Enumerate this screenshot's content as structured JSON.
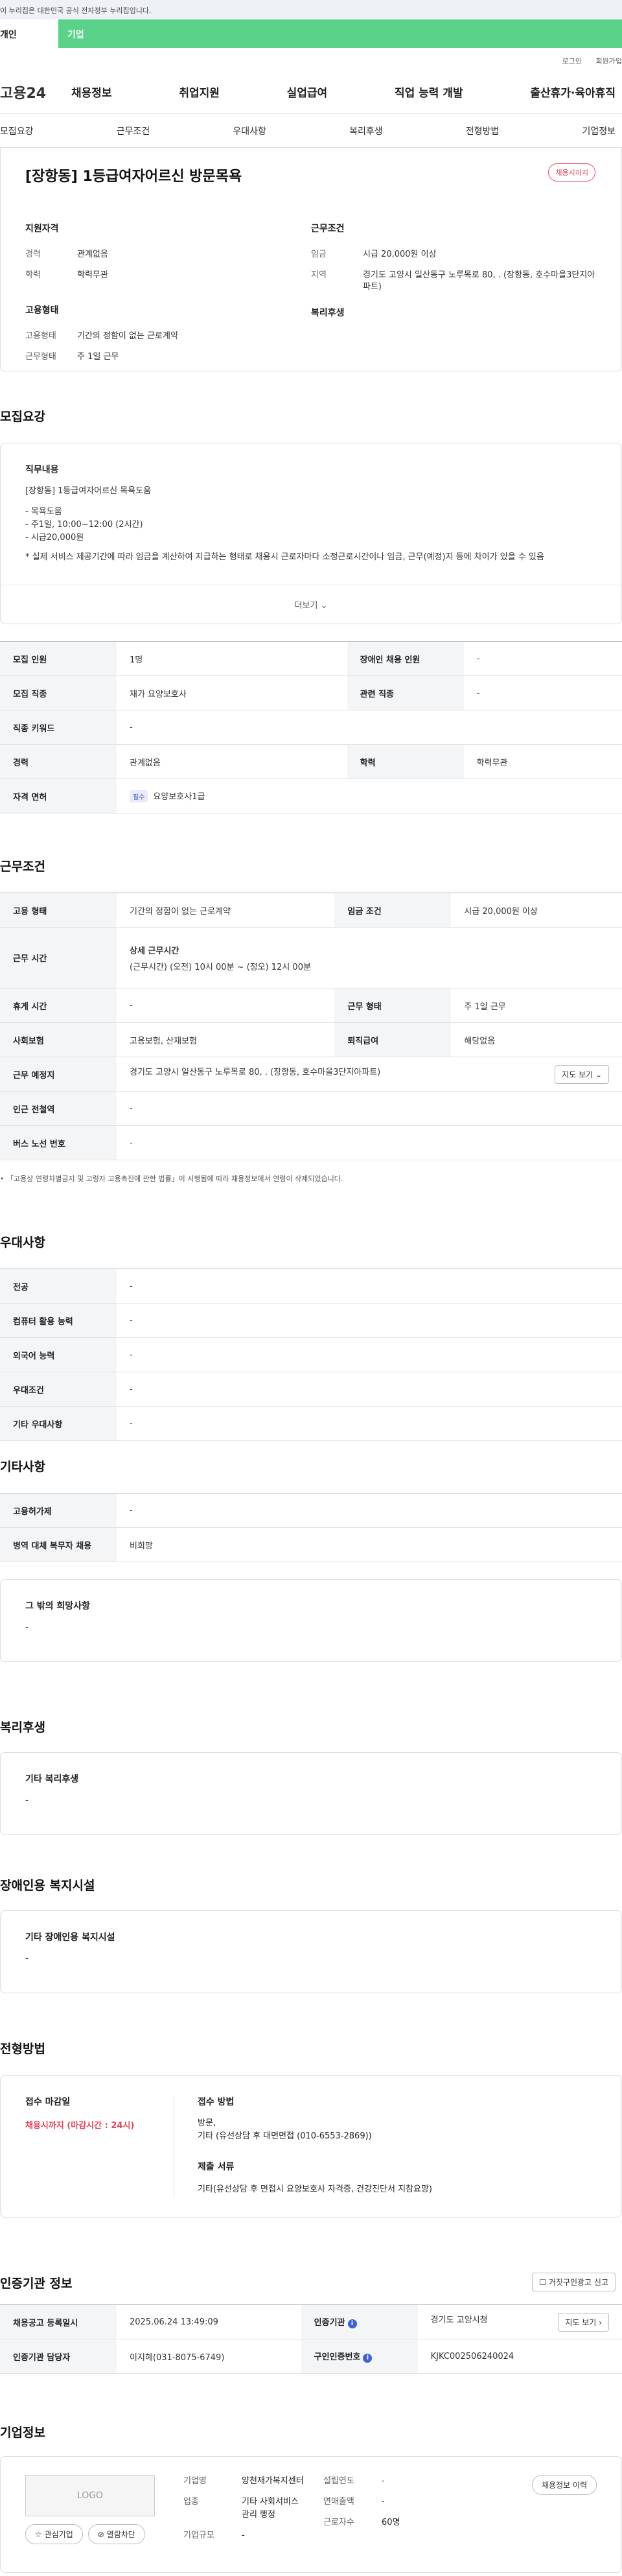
{
  "gov_banner": "이 누리집은 대한민국 공식 전자정부 누리집입니다.",
  "tabs": {
    "personal": "개인",
    "company": "기업"
  },
  "util": {
    "login": "로그인",
    "signup": "회원가입"
  },
  "gnb": {
    "logo": "고용24",
    "menu": [
      "채용정보",
      "취업지원",
      "실업급여",
      "직업 능력 개발",
      "출산휴가·육아휴직"
    ]
  },
  "subnav": [
    "모집요강",
    "근무조건",
    "우대사항",
    "복리후생",
    "전형방법",
    "기업정보"
  ],
  "summary": {
    "title": "[장항동] 1등급여자어르신 방문목욕",
    "deadline_badge": "채용시까지",
    "qual_title": "지원자격",
    "career_k": "경력",
    "career_v": "관계없음",
    "edu_k": "학력",
    "edu_v": "학력무관",
    "emp_title": "고용형태",
    "emptype_k": "고용형태",
    "emptype_v": "기간의 정함이 없는 근로계약",
    "worktype_k": "근무형태",
    "worktype_v": "주 1일 근무",
    "cond_title": "근무조건",
    "wage_k": "임금",
    "wage_v": "시급 20,000원 이상",
    "region_k": "지역",
    "region_v": "경기도 고양시 일산동구 노루목로 80, . (장항동, 호수마을3단지아파트)",
    "welfare_title": "복리후생"
  },
  "recruit": {
    "section_title": "모집요강",
    "duty_title": "직무내용",
    "duty_lines": [
      "[장항동] 1등급여자어르신 목욕도움",
      "",
      "- 목욕도움",
      "- 주1일, 10:00~12:00 (2시간)",
      "- 시급20,000원",
      "",
      "* 실제 서비스 제공기간에 따라 임금을 계산하여 지급하는 형태로 채용시 근로자마다 소정근로시간이나 임금, 근무(예정)지 등에 차이가 있을 수 있음"
    ],
    "more": "더보기",
    "rows": [
      {
        "k1": "모집 인원",
        "v1": "1명",
        "k2": "장애인 채용 인원",
        "v2": "-"
      },
      {
        "k1": "모집 직종",
        "v1": "재가 요양보호사",
        "k2": "관련 직종",
        "v2": "-"
      },
      {
        "k1": "직종 키워드",
        "v1": "-"
      },
      {
        "k1": "경력",
        "v1": "관계없음",
        "k2": "학력",
        "v2": "학력무관"
      },
      {
        "k1": "자격 면허",
        "chip": "필수",
        "v1": "요양보호사1급"
      }
    ]
  },
  "work": {
    "section_title": "근무조건",
    "emptype_k": "고용 형태",
    "emptype_v": "기간의 정함이 없는 근로계약",
    "wage_k": "임금 조건",
    "wage_v": "시급 20,000원 이상",
    "hours_k": "근무 시간",
    "hours_sub": "상세 근무시간",
    "hours_v": "(근무시간) (오전) 10시 00분 ~ (정오) 12시 00분",
    "rest_k": "휴게 시간",
    "rest_v": "-",
    "form_k": "근무 형태",
    "form_v": "주 1일 근무",
    "ins_k": "사회보험",
    "ins_v": "고용보험, 산재보험",
    "sev_k": "퇴직급여",
    "sev_v": "해당없음",
    "place_k": "근무 예정지",
    "place_v": "경기도 고양시 일산동구 노루목로 80, . (장항동, 호수마을3단지아파트)",
    "map_btn": "지도 보기",
    "subway_k": "인근 전철역",
    "subway_v": "-",
    "bus_k": "버스 노선 번호",
    "bus_v": "-",
    "note": "「고용상 연령차별금지 및 고령자 고용촉진에 관한 법률」이 시행됨에 따라 채용정보에서 연령이 삭제되었습니다."
  },
  "pref": {
    "section_title": "우대사항",
    "rows": [
      {
        "k": "전공",
        "v": "-"
      },
      {
        "k": "컴퓨터 활용 능력",
        "v": "-"
      },
      {
        "k": "외국어 능력",
        "v": "-"
      },
      {
        "k": "우대조건",
        "v": "-"
      },
      {
        "k": "기타 우대사항",
        "v": "-"
      }
    ]
  },
  "etc": {
    "section_title": "기타사항",
    "rows": [
      {
        "k": "고용허가제",
        "v": "-"
      },
      {
        "k": "병역 대체 복무자 채용",
        "v": "비희망"
      }
    ],
    "wish_title": "그 밖의 희망사항",
    "wish_v": "-"
  },
  "welfare": {
    "section_title": "복리후생",
    "box_title": "기타 복리후생",
    "box_v": "-"
  },
  "disabled": {
    "section_title": "장애인용 복지시설",
    "box_title": "기타 장애인용 복지시설",
    "box_v": "-"
  },
  "process": {
    "section_title": "전형방법",
    "deadline_k": "접수 마감일",
    "deadline_v": "채용시까지 (마감시간 : 24시)",
    "method_k": "접수 방법",
    "method_v1": "방문,",
    "method_v2": "기타 (유선상담 후 대면면접 (010-6553-2869))",
    "docs_k": "제출 서류",
    "docs_v": "기타(유선상담 후 면접시 요양보호사 자격증, 건강진단서 지참요망)"
  },
  "agency": {
    "section_title": "인증기관 정보",
    "report_btn": "거짓구인광고 신고",
    "reg_k": "채용공고 등록일시",
    "reg_v": "2025.06.24 13:49:09",
    "org_k": "인증기관",
    "org_v": "경기도 고양시청",
    "map_btn": "지도 보기",
    "mgr_k": "인증기관 담당자",
    "mgr_v": "이지혜(031-8075-6749)",
    "no_k": "구인인증번호",
    "no_v": "KJKC002506240024"
  },
  "company": {
    "section_title": "기업정보",
    "logo": "LOGO",
    "fav_btn": "관심기업",
    "block_btn": "열람차단",
    "name_k": "기업명",
    "name_v": "양천재가복지센터",
    "ind_k": "업종",
    "ind_v1": "기타 사회서비스",
    "ind_v2": "관리 행정",
    "size_k": "기업규모",
    "size_v": "-",
    "est_k": "설립연도",
    "est_v": "-",
    "sales_k": "연매출액",
    "sales_v": "-",
    "emp_k": "근로자수",
    "emp_v": "60명",
    "history_btn": "채용정보 이력"
  }
}
